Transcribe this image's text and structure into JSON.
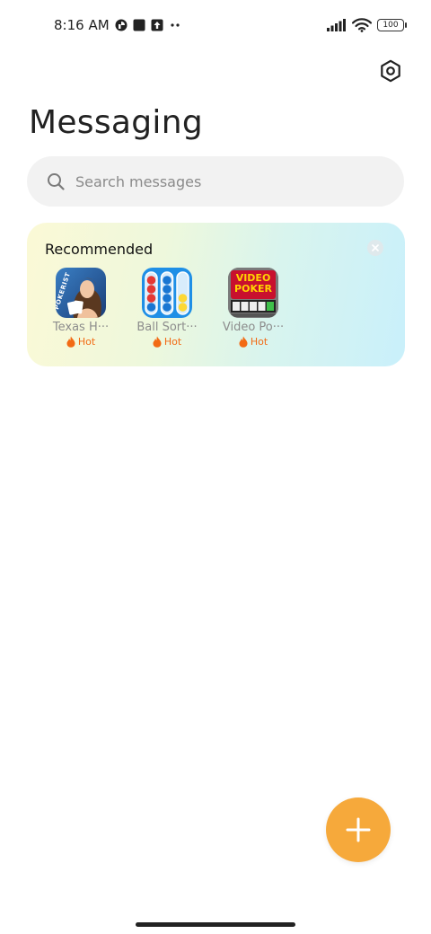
{
  "status_bar": {
    "time": "8:16 AM",
    "battery": "100"
  },
  "header": {
    "title": "Messaging",
    "settings_icon": "settings-hexagon-icon"
  },
  "search": {
    "placeholder": "Search messages",
    "icon": "search-icon"
  },
  "recommended": {
    "title": "Recommended",
    "close_icon": "close-icon",
    "apps": [
      {
        "name": "Texas H···",
        "badge": "Hot",
        "icon": "texas-holdem-app-icon"
      },
      {
        "name": "Ball Sort···",
        "badge": "Hot",
        "icon": "ball-sort-app-icon"
      },
      {
        "name": "Video Po···",
        "badge": "Hot",
        "icon": "video-poker-app-icon"
      }
    ],
    "video_poker_icon_text": [
      "VIDEO",
      "POKER"
    ],
    "pokerist_text": "POKERIST"
  },
  "fab": {
    "icon": "plus-icon"
  },
  "colors": {
    "accent": "#f6a93b",
    "hot": "#f26a14",
    "search_bg": "#f2f2f2"
  }
}
